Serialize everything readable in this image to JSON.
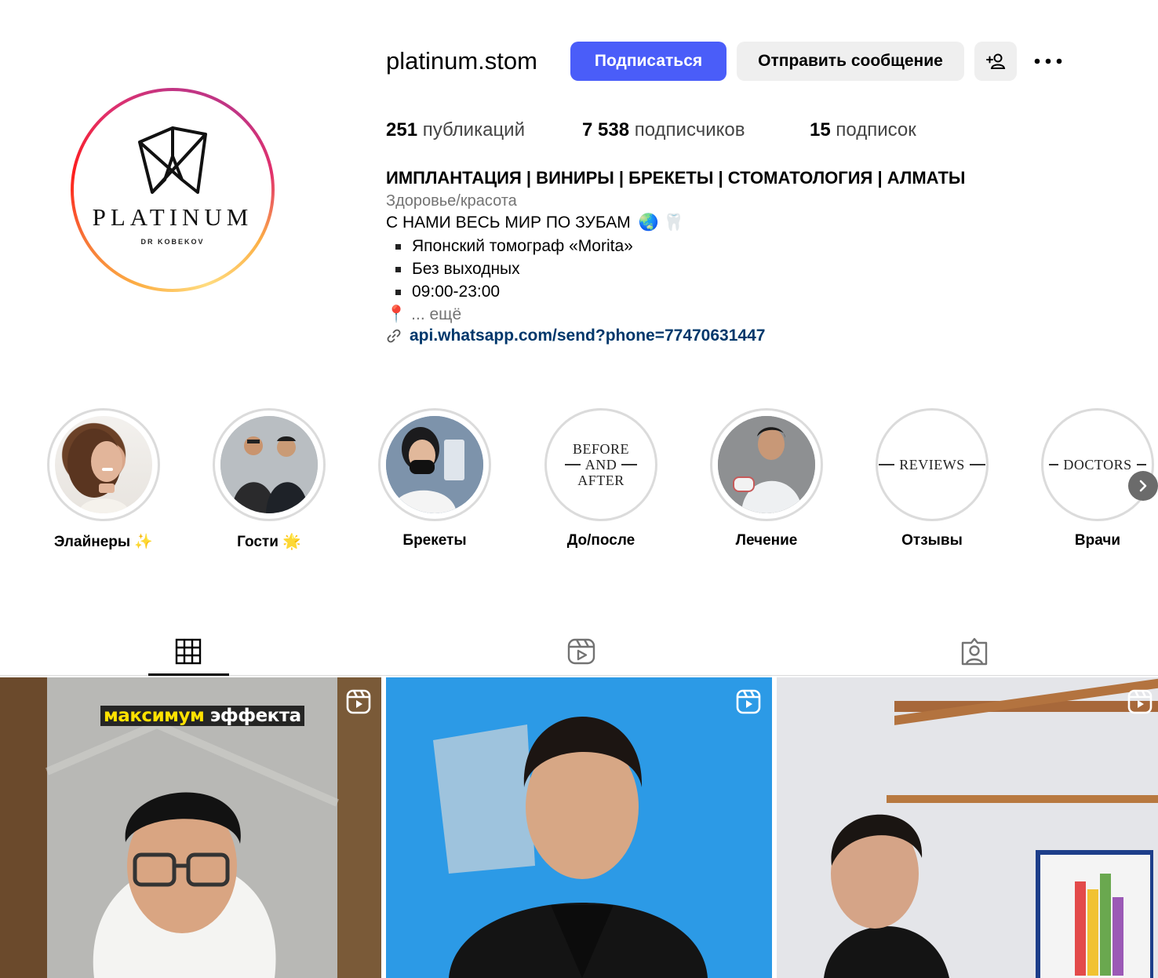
{
  "profile": {
    "username": "platinum.stom",
    "follow_label": "Подписаться",
    "message_label": "Отправить сообщение",
    "avatar": {
      "word": "PLATINUM",
      "sub": "DR KOBEKOV"
    }
  },
  "stats": {
    "posts_count": "251",
    "posts_label": "публикаций",
    "followers_count": "7 538",
    "followers_label": "подписчиков",
    "following_count": "15",
    "following_label": "подписок"
  },
  "bio": {
    "name": "ИМПЛАНТАЦИЯ | ВИНИРЫ | БРЕКЕТЫ | СТОМАТОЛОГИЯ | АЛМАТЫ",
    "category": "Здоровье/красота",
    "tagline": "С НАМИ ВЕСЬ МИР ПО ЗУБАМ",
    "tagline_emojis": "🌏 🦷",
    "bullets": [
      "Японский томограф «Morita»",
      "Без выходных",
      "09:00-23:00"
    ],
    "location_pin": "📍",
    "more_label": "... ещё",
    "link": "api.whatsapp.com/send?phone=77470631447"
  },
  "highlights": [
    {
      "label": "Элайнеры",
      "emoji": "✨",
      "type": "photo"
    },
    {
      "label": "Гости",
      "emoji": "🌟",
      "type": "photo"
    },
    {
      "label": "Брекеты",
      "emoji": "",
      "type": "photo"
    },
    {
      "label": "До/после",
      "emoji": "",
      "type": "text",
      "text": [
        "BEFORE",
        "AND",
        "AFTER"
      ]
    },
    {
      "label": "Лечение",
      "emoji": "",
      "type": "photo"
    },
    {
      "label": "Отзывы",
      "emoji": "",
      "type": "text",
      "text": [
        "REVIEWS"
      ]
    },
    {
      "label": "Врачи",
      "emoji": "",
      "type": "text",
      "text": [
        "DOCTORS"
      ]
    }
  ],
  "tabs": [
    {
      "name": "posts",
      "icon": "grid-icon",
      "active": true
    },
    {
      "name": "reels",
      "icon": "reels-icon",
      "active": false
    },
    {
      "name": "tagged",
      "icon": "tagged-icon",
      "active": false
    }
  ],
  "posts": [
    {
      "type": "reel",
      "caption_highlight": "максимум",
      "caption_rest": "эффекта"
    },
    {
      "type": "reel"
    },
    {
      "type": "reel"
    }
  ],
  "colors": {
    "follow_button": "#4a5df9",
    "secondary_button": "#efefef",
    "link": "#00376b",
    "muted_text": "#737373"
  }
}
